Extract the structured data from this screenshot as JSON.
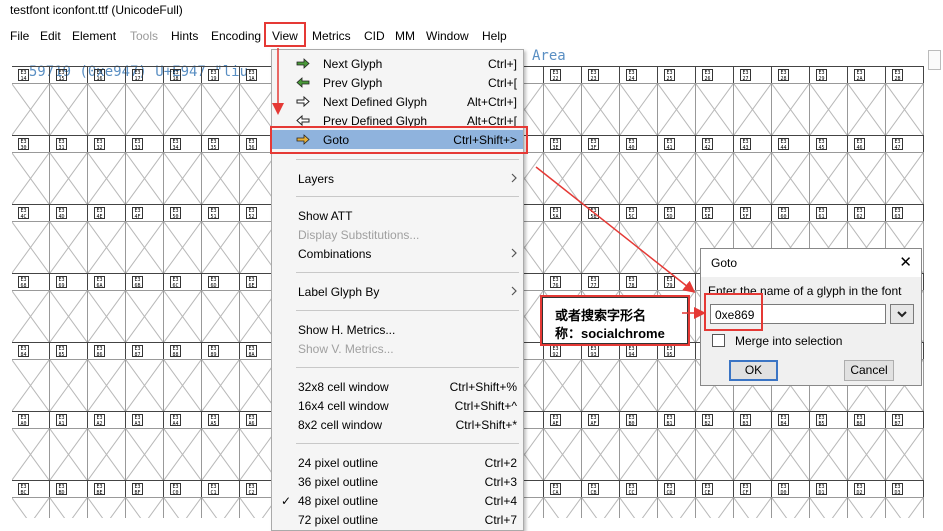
{
  "window": {
    "title": "testfont  iconfont.ttf (UnicodeFull)"
  },
  "menubar": [
    {
      "label": "File",
      "disabled": false
    },
    {
      "label": "Edit",
      "disabled": false
    },
    {
      "label": "Element",
      "disabled": false
    },
    {
      "label": "Tools",
      "disabled": true
    },
    {
      "label": "Hints",
      "disabled": false
    },
    {
      "label": "Encoding",
      "disabled": false
    },
    {
      "label": "View",
      "disabled": false
    },
    {
      "label": "Metrics",
      "disabled": false
    },
    {
      "label": "CID",
      "disabled": false
    },
    {
      "label": "MM",
      "disabled": false
    },
    {
      "label": "Window",
      "disabled": false
    },
    {
      "label": "Help",
      "disabled": false
    }
  ],
  "infoline": {
    "left": "59719 (0xe947) U+E947 \"liu",
    "right": "Area"
  },
  "glyph_rows": [
    [
      "E3 14",
      "E3 15",
      "E3 16",
      "E3 17",
      "E3 18",
      "E3 19",
      "E3 1A",
      "E3 1B",
      "E3 1C",
      "E3 1D",
      "E3 1E",
      "E3 1F",
      "E3 20",
      "E3 21",
      "E3 22",
      "E3 23",
      "E3 24",
      "E3 25",
      "E3 26",
      "E3 27",
      "E3 28",
      "E3 29",
      "E3 2A",
      "E3 2B"
    ],
    [
      "E3 30",
      "E3 31",
      "E3 32",
      "E3 33",
      "E3 34",
      "E3 35",
      "E3 36",
      "E3 37",
      "E3 38",
      "E3 39",
      "E3 3A",
      "E3 3B",
      "E3 3C",
      "E3 3D",
      "E3 3E",
      "E3 3F",
      "E3 40",
      "E3 41",
      "E3 42",
      "E3 43",
      "E3 44",
      "E3 45",
      "E3 46",
      "E3 47"
    ],
    [
      "E3 4C",
      "E3 4D",
      "E3 4E",
      "E3 4F",
      "E3 50",
      "E3 51",
      "E3 52",
      "E3 53",
      "E3 54",
      "E3 55",
      "E3 56",
      "E3 57",
      "E3 58",
      "E3 59",
      "E3 5A",
      "E3 5B",
      "E3 5C",
      "E3 5D",
      "E3 5E",
      "E3 5F",
      "E3 60",
      "E3 61",
      "E3 62",
      "E3 63"
    ],
    [
      "E3 68",
      "E3 69",
      "E3 6A",
      "E3 6B",
      "E3 6C",
      "E3 6D",
      "E3 6E",
      "E3 6F",
      "E3 70",
      "E3 71",
      "E3 72",
      "E3 73",
      "E3 74",
      "E3 75",
      "E3 76",
      "E3 77",
      "E3 78",
      "E3 79",
      "E3 7A",
      "E3 7B",
      "E3 7C",
      "E3 7D",
      "E3 7E",
      "E3 7F"
    ],
    [
      "E3 84",
      "E3 85",
      "E3 86",
      "E3 87",
      "E3 88",
      "E3 89",
      "E3 8A",
      "E3 8B",
      "E3 8C",
      "E3 8D",
      "E3 8E",
      "E3 8F",
      "E3 90",
      "E3 91",
      "E3 92",
      "E3 93",
      "E3 94",
      "E3 95",
      "E3 96",
      "E3 97",
      "E3 98",
      "E3 99",
      "E3 9A",
      "E3 9B"
    ],
    [
      "E3 A0",
      "E3 A1",
      "E3 A2",
      "E3 A3",
      "E3 A4",
      "E3 A5",
      "E3 A6",
      "E3 A7",
      "E3 A8",
      "E3 A9",
      "E3 AA",
      "E3 AB",
      "E3 AC",
      "E3 AD",
      "E3 AE",
      "E3 AF",
      "E3 B0",
      "E3 B1",
      "E3 B2",
      "E3 B3",
      "E3 B4",
      "E3 B5",
      "E3 B6",
      "E3 B7"
    ],
    [
      "E3 BC",
      "E3 BD",
      "E3 BE",
      "E3 BF",
      "E3 C0",
      "E3 C1",
      "E3 C2",
      "E3 C3",
      "E3 C4",
      "E3 C5",
      "E3 C6",
      "E3 C7",
      "E3 C8",
      "E3 C9",
      "E3 CA",
      "E3 CB",
      "E3 CC",
      "E3 CD",
      "E3 CE",
      "E3 CF",
      "E3 D0",
      "E3 D1",
      "E3 D2",
      "E3 D3"
    ]
  ],
  "view_menu": {
    "items": [
      {
        "label": "Next Glyph",
        "shortcut": "Ctrl+]",
        "icon": "arrow-right-icon"
      },
      {
        "label": "Prev Glyph",
        "shortcut": "Ctrl+[",
        "icon": "arrow-left-icon"
      },
      {
        "label": "Next Defined Glyph",
        "shortcut": "Alt+Ctrl+]",
        "icon": "arrow-right-defined-icon"
      },
      {
        "label": "Prev Defined Glyph",
        "shortcut": "Alt+Ctrl+[",
        "icon": "arrow-left-defined-icon"
      },
      {
        "label": "Goto",
        "shortcut": "Ctrl+Shift+>",
        "icon": "goto-icon",
        "highlighted": true
      },
      {
        "label": "Layers",
        "submenu": true
      },
      {
        "label": "Show ATT"
      },
      {
        "label": "Display Substitutions...",
        "disabled": true
      },
      {
        "label": "Combinations",
        "submenu": true
      },
      {
        "label": "Label Glyph By",
        "submenu": true
      },
      {
        "label": "Show H. Metrics..."
      },
      {
        "label": "Show V. Metrics...",
        "disabled": true
      },
      {
        "label": "32x8 cell window",
        "shortcut": "Ctrl+Shift+%"
      },
      {
        "label": "16x4 cell window",
        "shortcut": "Ctrl+Shift+^"
      },
      {
        "label": "8x2  cell window",
        "shortcut": "Ctrl+Shift+*"
      },
      {
        "label": "24 pixel outline",
        "shortcut": "Ctrl+2"
      },
      {
        "label": "36 pixel outline",
        "shortcut": "Ctrl+3"
      },
      {
        "label": "48 pixel outline",
        "shortcut": "Ctrl+4",
        "checked": true
      },
      {
        "label": "72 pixel outline",
        "shortcut": "Ctrl+7"
      }
    ],
    "check_mark": "✓"
  },
  "goto_dialog": {
    "title": "Goto",
    "close": "✕",
    "prompt": "Enter the name of a glyph in the font",
    "value": "0xe869",
    "merge_label": "Merge into selection",
    "merge_checked": false,
    "ok_label": "OK",
    "cancel_label": "Cancel"
  },
  "callout": {
    "line1": "或者搜索字形名",
    "line2": "称：socialchrome"
  },
  "colors": {
    "annotation": "#e53935",
    "highlight": "#8fb3dd",
    "info_text": "#5a8fc3"
  }
}
